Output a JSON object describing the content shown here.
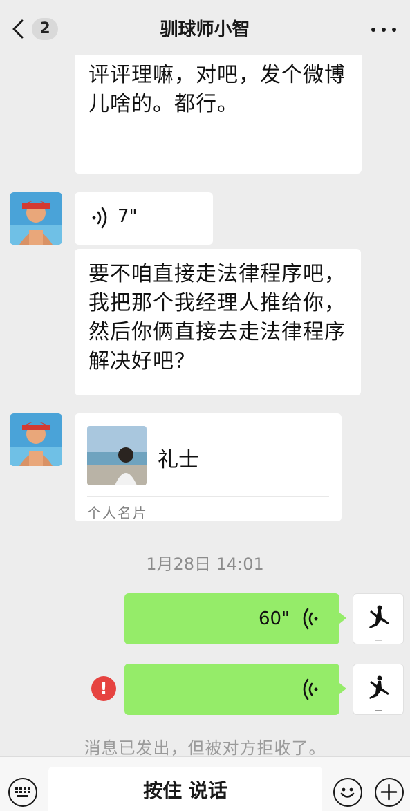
{
  "header": {
    "title": "驯球师小智",
    "unread_count": "2"
  },
  "messages": {
    "partial_text": "需要道个歉呢，还是怎么着呢？咱们可以让让让让大家评评理嘛，对吧，发个微博儿啥的。都行。",
    "voice_in_duration": "7\"",
    "text_2": "要不咱直接走法律程序吧，我把那个我经理人推给你，然后你俩直接去走法律程序解决好吧？",
    "card_name": "礼士",
    "card_label": "个人名片",
    "timestamp": "1月28日 14:01",
    "voice_out_duration": "60\"",
    "error_mark": "!",
    "system_note": "消息已发出，但被对方拒收了。"
  },
  "bottom": {
    "hold_to_talk": "按住 说话"
  },
  "colors": {
    "background": "#ededed",
    "bubble_out": "#95ec69",
    "bubble_in": "#ffffff",
    "error": "#e64340"
  }
}
